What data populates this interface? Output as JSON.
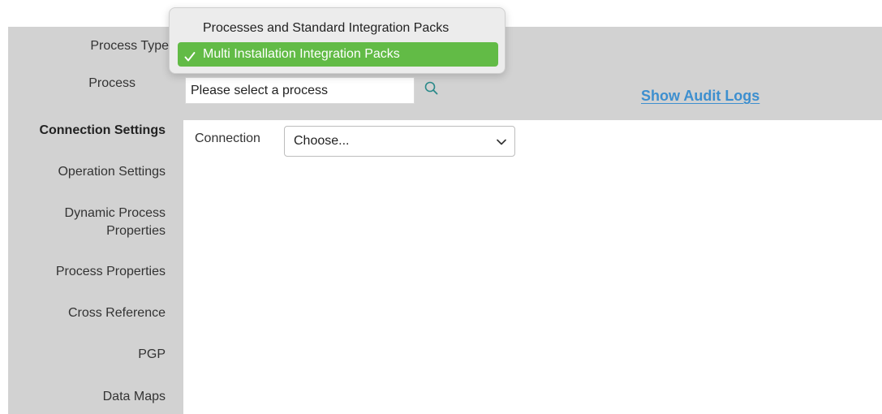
{
  "header": {
    "process_type_label": "Process Type",
    "process_label": "Process",
    "process_placeholder": "Please select a process",
    "audit_link": "Show Audit Logs"
  },
  "dropdown": {
    "options": [
      {
        "label": "Processes and Standard Integration Packs",
        "selected": false
      },
      {
        "label": "Multi Installation Integration Packs",
        "selected": true
      }
    ]
  },
  "sidebar": {
    "items": [
      {
        "label": "Connection Settings",
        "active": true
      },
      {
        "label": "Operation Settings",
        "active": false
      },
      {
        "label": "Dynamic Process Properties",
        "active": false
      },
      {
        "label": "Process Properties",
        "active": false
      },
      {
        "label": "Cross Reference",
        "active": false
      },
      {
        "label": "PGP",
        "active": false
      },
      {
        "label": "Data Maps",
        "active": false
      }
    ]
  },
  "content": {
    "connection_label": "Connection",
    "connection_value": "Choose..."
  },
  "icons": {
    "search": "search-icon",
    "chevron": "chevron-down-icon",
    "check": "check-icon"
  },
  "colors": {
    "band": "#d2d2d2",
    "accent_link": "#3d8fcf",
    "selected_option": "#62bb46",
    "search_icon": "#2b8a8a"
  }
}
